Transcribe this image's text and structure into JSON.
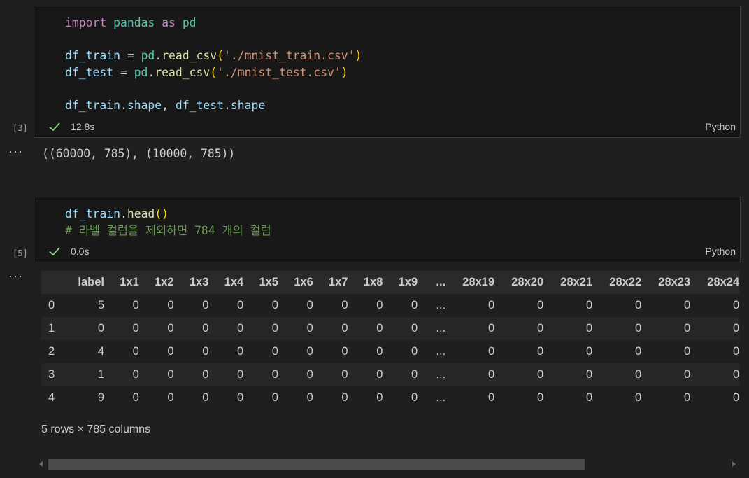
{
  "cell1": {
    "exec_count": "[3]",
    "lines": [
      [
        {
          "t": "import",
          "c": "kw"
        },
        {
          "t": " ",
          "c": "op"
        },
        {
          "t": "pandas",
          "c": "mod"
        },
        {
          "t": " ",
          "c": "op"
        },
        {
          "t": "as",
          "c": "kw"
        },
        {
          "t": " ",
          "c": "op"
        },
        {
          "t": "pd",
          "c": "mod"
        }
      ],
      [],
      [
        {
          "t": "df_train",
          "c": "var"
        },
        {
          "t": " = ",
          "c": "op"
        },
        {
          "t": "pd",
          "c": "mod"
        },
        {
          "t": ".",
          "c": "op"
        },
        {
          "t": "read_csv",
          "c": "fn"
        },
        {
          "t": "(",
          "c": "paren"
        },
        {
          "t": "'./mnist_train.csv'",
          "c": "str"
        },
        {
          "t": ")",
          "c": "paren"
        }
      ],
      [
        {
          "t": "df_test",
          "c": "var"
        },
        {
          "t": " = ",
          "c": "op"
        },
        {
          "t": "pd",
          "c": "mod"
        },
        {
          "t": ".",
          "c": "op"
        },
        {
          "t": "read_csv",
          "c": "fn"
        },
        {
          "t": "(",
          "c": "paren"
        },
        {
          "t": "'./mnist_test.csv'",
          "c": "str"
        },
        {
          "t": ")",
          "c": "paren"
        }
      ],
      [],
      [
        {
          "t": "df_train",
          "c": "var"
        },
        {
          "t": ".",
          "c": "op"
        },
        {
          "t": "shape",
          "c": "var"
        },
        {
          "t": ", ",
          "c": "op"
        },
        {
          "t": "df_test",
          "c": "var"
        },
        {
          "t": ".",
          "c": "op"
        },
        {
          "t": "shape",
          "c": "var"
        }
      ]
    ],
    "elapsed": "12.8s",
    "language": "Python",
    "output": "((60000, 785), (10000, 785))"
  },
  "cell2": {
    "exec_count": "[5]",
    "lines": [
      [
        {
          "t": "df_train",
          "c": "var"
        },
        {
          "t": ".",
          "c": "op"
        },
        {
          "t": "head",
          "c": "fn"
        },
        {
          "t": "()",
          "c": "paren"
        }
      ],
      [
        {
          "t": "# 라벨 컬럼을 제외하면 784 개의 컬럼",
          "c": "comment"
        }
      ]
    ],
    "elapsed": "0.0s",
    "language": "Python"
  },
  "ellipsis": "···",
  "dataframe": {
    "columns": [
      "",
      "label",
      "1x1",
      "1x2",
      "1x3",
      "1x4",
      "1x5",
      "1x6",
      "1x7",
      "1x8",
      "1x9",
      "...",
      "28x19",
      "28x20",
      "28x21",
      "28x22",
      "28x23",
      "28x24"
    ],
    "rows": [
      [
        "0",
        "5",
        "0",
        "0",
        "0",
        "0",
        "0",
        "0",
        "0",
        "0",
        "0",
        "...",
        "0",
        "0",
        "0",
        "0",
        "0",
        "0"
      ],
      [
        "1",
        "0",
        "0",
        "0",
        "0",
        "0",
        "0",
        "0",
        "0",
        "0",
        "0",
        "...",
        "0",
        "0",
        "0",
        "0",
        "0",
        "0"
      ],
      [
        "2",
        "4",
        "0",
        "0",
        "0",
        "0",
        "0",
        "0",
        "0",
        "0",
        "0",
        "...",
        "0",
        "0",
        "0",
        "0",
        "0",
        "0"
      ],
      [
        "3",
        "1",
        "0",
        "0",
        "0",
        "0",
        "0",
        "0",
        "0",
        "0",
        "0",
        "...",
        "0",
        "0",
        "0",
        "0",
        "0",
        "0"
      ],
      [
        "4",
        "9",
        "0",
        "0",
        "0",
        "0",
        "0",
        "0",
        "0",
        "0",
        "0",
        "...",
        "0",
        "0",
        "0",
        "0",
        "0",
        "0"
      ]
    ],
    "shape_text": "5 rows × 785 columns"
  },
  "colors": {
    "background": "#1f1f1f",
    "cell_background": "#181818",
    "success": "#89d185"
  }
}
